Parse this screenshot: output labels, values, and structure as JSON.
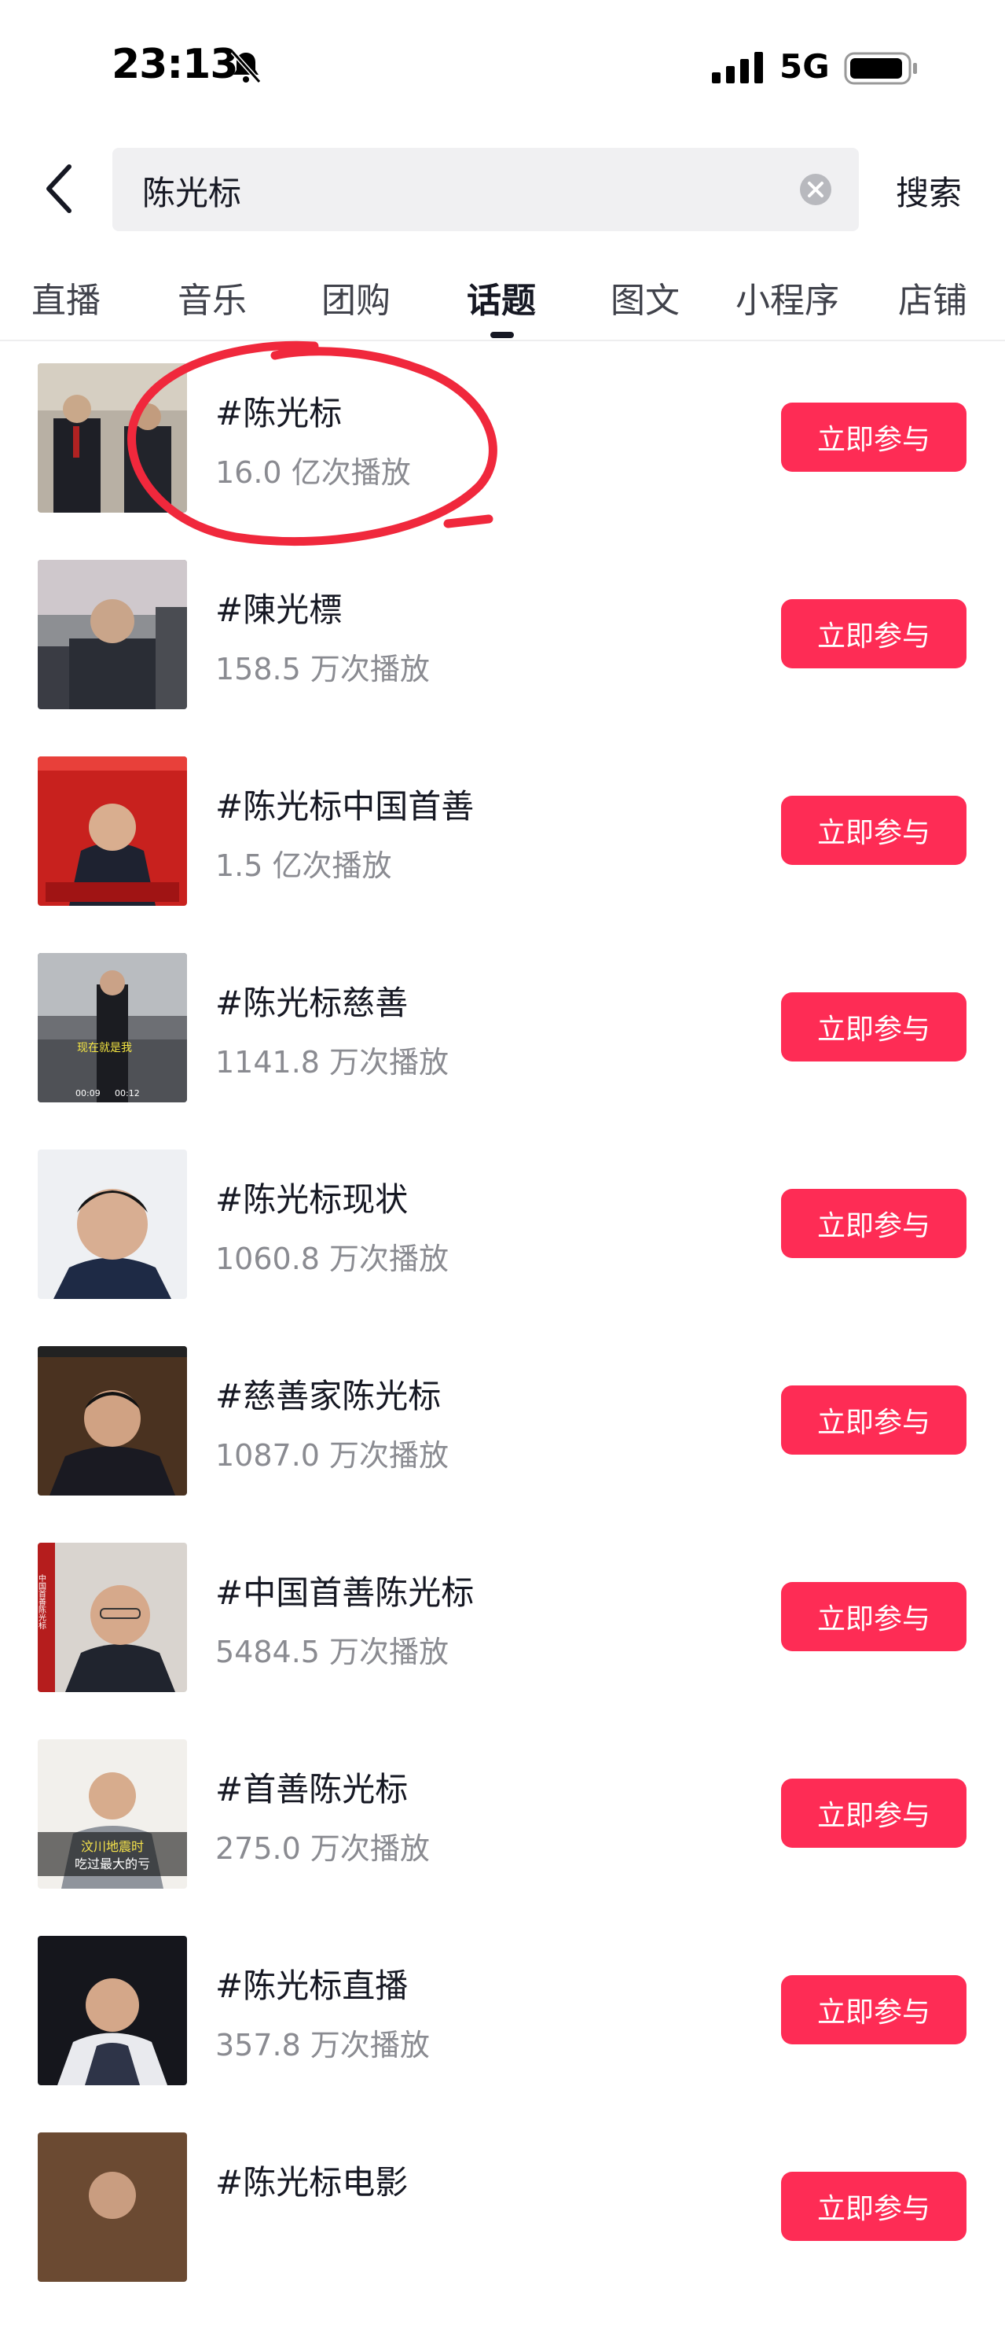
{
  "status_bar": {
    "time": "23:13",
    "network": "5G"
  },
  "search": {
    "query": "陈光标",
    "button_label": "搜索"
  },
  "tabs": [
    {
      "label": "直播",
      "active": false
    },
    {
      "label": "音乐",
      "active": false
    },
    {
      "label": "团购",
      "active": false
    },
    {
      "label": "话题",
      "active": true
    },
    {
      "label": "图文",
      "active": false
    },
    {
      "label": "小程序",
      "active": false
    },
    {
      "label": "店铺",
      "active": false
    }
  ],
  "topics": [
    {
      "title": "#陈光标",
      "plays": "16.0 亿次播放",
      "button": "立即参与"
    },
    {
      "title": "#陳光標",
      "plays": "158.5 万次播放",
      "button": "立即参与"
    },
    {
      "title": "#陈光标中国首善",
      "plays": "1.5 亿次播放",
      "button": "立即参与"
    },
    {
      "title": "#陈光标慈善",
      "plays": "1141.8 万次播放",
      "button": "立即参与"
    },
    {
      "title": "#陈光标现状",
      "plays": "1060.8 万次播放",
      "button": "立即参与"
    },
    {
      "title": "#慈善家陈光标",
      "plays": "1087.0 万次播放",
      "button": "立即参与"
    },
    {
      "title": "#中国首善陈光标",
      "plays": "5484.5 万次播放",
      "button": "立即参与"
    },
    {
      "title": "#首善陈光标",
      "plays": "275.0 万次播放",
      "button": "立即参与"
    },
    {
      "title": "#陈光标直播",
      "plays": "357.8 万次播放",
      "button": "立即参与"
    },
    {
      "title": "#陈光标电影",
      "plays": "",
      "button": "立即参与"
    }
  ],
  "thumb_captions": {
    "t4_overlay": "现在就是我",
    "t4_time_a": "00:09",
    "t4_time_b": "00:12",
    "t7_side": "中国首善陈光标",
    "t8_line1": "汶川地震时",
    "t8_line2": "吃过最大的亏"
  },
  "colors": {
    "accent": "#fe2c55",
    "annotation": "#f0283c"
  }
}
